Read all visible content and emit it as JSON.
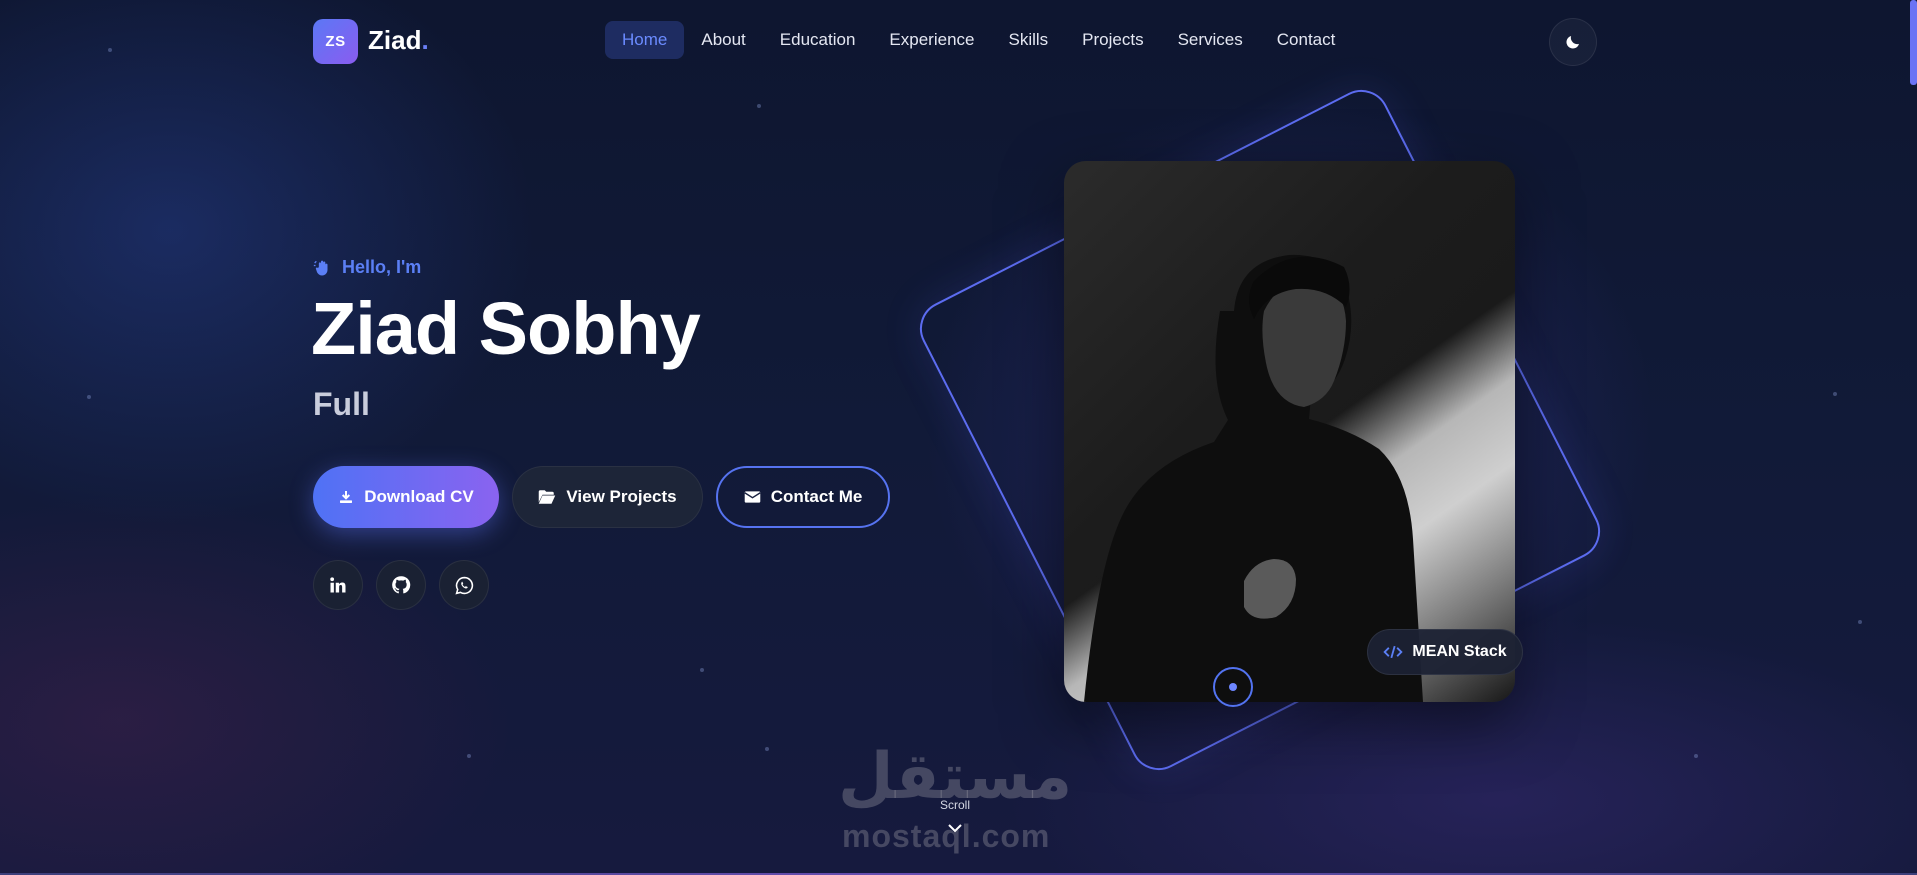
{
  "brand": {
    "badge": "ZS",
    "name": "Ziad",
    "dot": "."
  },
  "nav": {
    "items": [
      {
        "label": "Home",
        "active": true
      },
      {
        "label": "About"
      },
      {
        "label": "Education"
      },
      {
        "label": "Experience"
      },
      {
        "label": "Skills"
      },
      {
        "label": "Projects"
      },
      {
        "label": "Services"
      },
      {
        "label": "Contact"
      }
    ],
    "theme_icon": "moon-icon"
  },
  "hero": {
    "greeting": "Hello, I'm",
    "greeting_icon": "waving-hand-icon",
    "name": "Ziad Sobhy",
    "role": "Full",
    "buttons": {
      "download": {
        "label": "Download CV",
        "icon": "download-icon"
      },
      "projects": {
        "label": "View Projects",
        "icon": "folder-open-icon"
      },
      "contact": {
        "label": "Contact Me",
        "icon": "envelope-icon"
      }
    },
    "social": [
      {
        "name": "linkedin-icon"
      },
      {
        "name": "github-icon"
      },
      {
        "name": "whatsapp-icon"
      }
    ]
  },
  "profile": {
    "badge_label": "MEAN Stack",
    "badge_icon": "code-icon"
  },
  "scroll": {
    "label": "Scroll"
  },
  "watermark": {
    "arabic": "مستقل",
    "latin": "mostaql.com"
  },
  "colors": {
    "accent": "#5b7ff5",
    "gradient_start": "#4f72f5",
    "gradient_end": "#8a63f0",
    "background": "#111a38"
  }
}
